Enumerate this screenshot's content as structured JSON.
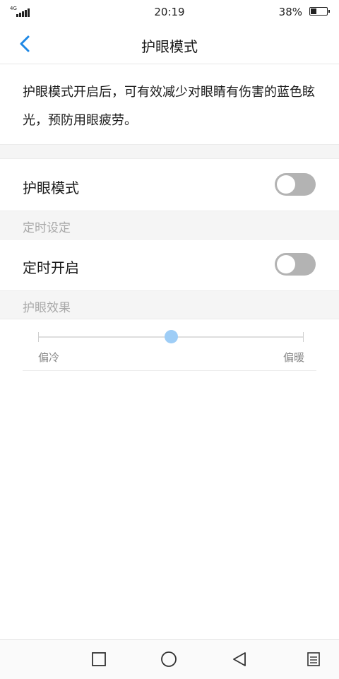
{
  "status_bar": {
    "network": "4G",
    "time": "20:19",
    "battery_percent": "38%",
    "battery_level": 0.38
  },
  "header": {
    "title": "护眼模式"
  },
  "description": "护眼模式开启后，可有效减少对眼睛有伤害的蓝色眩光，预防用眼疲劳。",
  "eye_mode_row": {
    "label": "护眼模式",
    "enabled": false
  },
  "timer_section": {
    "label": "定时设定"
  },
  "timer_row": {
    "label": "定时开启",
    "enabled": false
  },
  "effect_section": {
    "label": "护眼效果"
  },
  "effect_slider": {
    "min_label": "偏冷",
    "max_label": "偏暖",
    "value": 0.5
  },
  "nav_bar": {
    "items": [
      "recent-apps",
      "home",
      "back",
      "menu"
    ]
  },
  "colors": {
    "accent": "#1e88e5",
    "toggle_off": "#b3b3b3",
    "slider_thumb": "#9ecdf6",
    "section_bg": "#f5f5f5"
  }
}
